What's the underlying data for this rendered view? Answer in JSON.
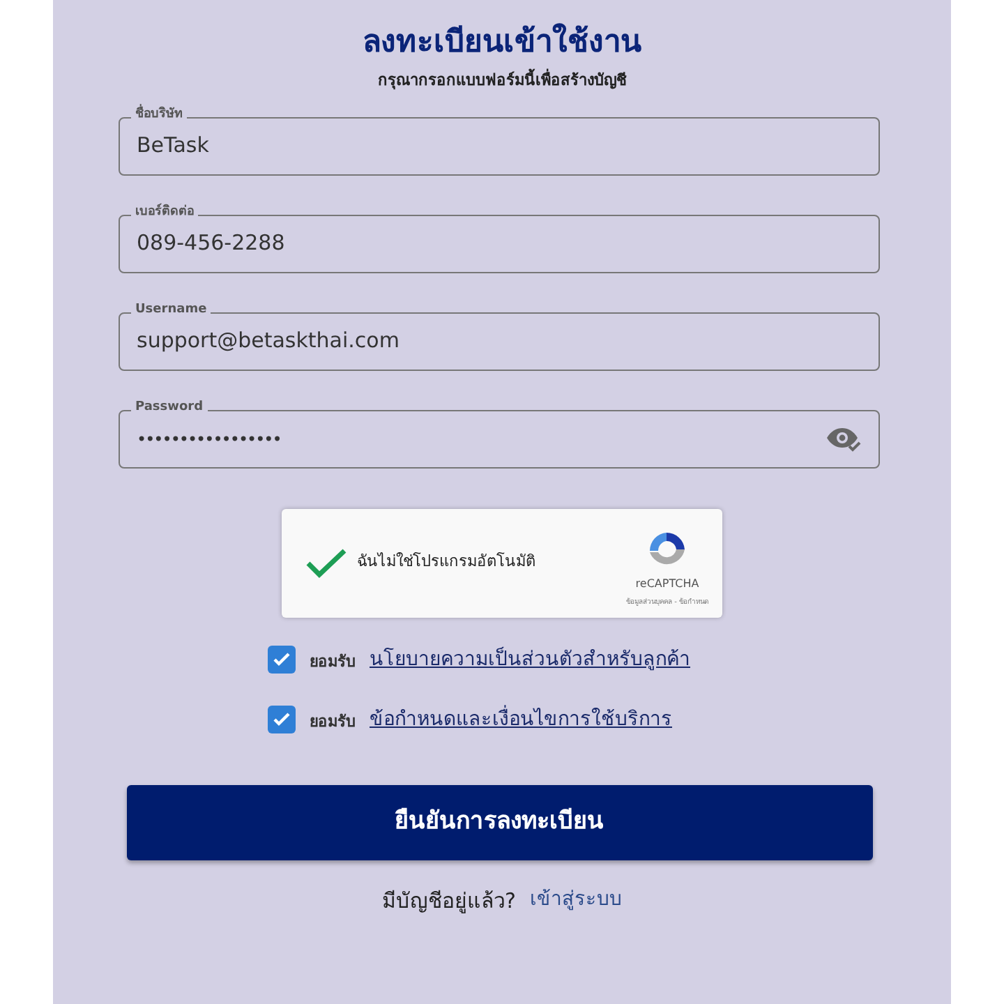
{
  "title": "ลงทะเบียนเข้าใช้งาน",
  "subtitle": "กรุณากรอกแบบฟอร์มนี้เพื่อสร้างบัญชี",
  "fields": [
    {
      "label": "ชื่อบริษัท",
      "value": "BeTask",
      "kind": "text"
    },
    {
      "label": "เบอร์ติดต่อ",
      "value": "089-456-2288",
      "kind": "text"
    },
    {
      "label": "Username",
      "value": "support@betaskthai.com",
      "kind": "text"
    },
    {
      "label": "Password",
      "value": "•••••••••••••••••",
      "kind": "password"
    }
  ],
  "captcha": {
    "label": "ฉันไม่ใช่โปรแกรมอัตโนมัติ",
    "checked": true,
    "brand": "reCAPTCHA",
    "links": "ข้อมูลส่วนบุคคล - ข้อกำหนด"
  },
  "agreements": [
    {
      "prefix": "ยอมรับ",
      "link": "นโยบายความเป็นส่วนตัวสำหรับลูกค้า",
      "checked": true
    },
    {
      "prefix": "ยอมรับ",
      "link": "ข้อกำหนดและเงื่อนไขการใช้บริการ",
      "checked": true
    }
  ],
  "submit": "ยืนยันการลงทะเบียน",
  "footer": {
    "text": "มีบัญชีอยู่แล้ว?",
    "link": "เข้าสู่ระบบ"
  }
}
